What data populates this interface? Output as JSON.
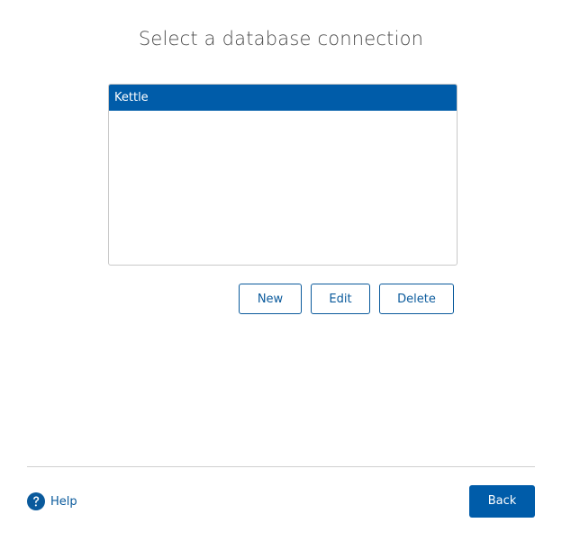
{
  "dialog": {
    "title": "Select a database connection"
  },
  "connections": {
    "items": [
      {
        "label": "Kettle",
        "selected": true
      }
    ]
  },
  "actions": {
    "new_label": "New",
    "edit_label": "Edit",
    "delete_label": "Delete"
  },
  "footer": {
    "help_label": "Help",
    "help_icon": "question-circle-icon",
    "back_label": "Back"
  },
  "colors": {
    "accent": "#005ca9",
    "link": "#0a5a9c",
    "divider": "#cfcfcf"
  }
}
